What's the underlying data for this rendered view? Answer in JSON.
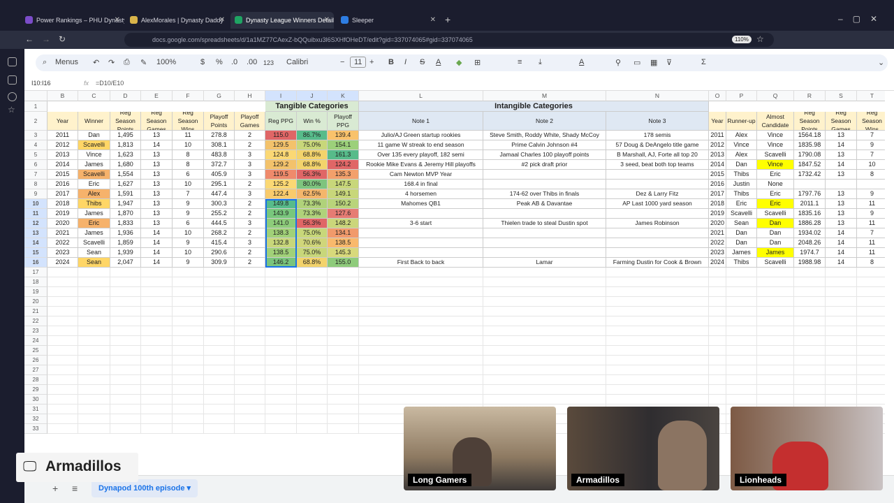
{
  "browser": {
    "tabs": [
      "Power Rankings – PHU Dynasty",
      "AlexMorales | Dynasty Daddy",
      "Dynasty League Winners Detail",
      "Sleeper"
    ],
    "url": "docs.google.com/spreadsheets/d/1a1MZ77CAexZ-bQQuibxu3l6SXHfOHeDT/edit?gid=337074065#gid=337074065",
    "zoom": "110%"
  },
  "toolbar": {
    "menus": "Menus",
    "zoom": "100%",
    "currency": "$",
    "percent": "%",
    "dec_minus": ".0",
    "dec_plus": ".00",
    "format_num": "123",
    "font": "Calibri",
    "font_size": "11",
    "bold": "B",
    "italic": "I",
    "strike": "S",
    "text_color": "A",
    "sum": "Σ"
  },
  "formula_bar": {
    "name_box": "I10:I16",
    "fx": "fx",
    "formula": "=D10/E10"
  },
  "columns": [
    "B",
    "C",
    "D",
    "E",
    "F",
    "G",
    "H",
    "I",
    "J",
    "K",
    "L",
    "M",
    "N",
    "O",
    "P",
    "Q",
    "R",
    "S",
    "T"
  ],
  "row_numbers": [
    "1",
    "2",
    "3",
    "4",
    "5",
    "6",
    "7",
    "8",
    "9",
    "10",
    "11",
    "12",
    "13",
    "14",
    "15",
    "16",
    "17",
    "18",
    "19",
    "20",
    "21",
    "22",
    "23",
    "24",
    "25",
    "26",
    "27",
    "28",
    "29",
    "30",
    "31",
    "32",
    "33"
  ],
  "group_headers": {
    "tangible": "Tangible Categories",
    "intangible": "Intangible Categories"
  },
  "headers": [
    "Year",
    "Winner",
    "Reg Season Points",
    "Reg Season Games",
    "Reg Season Wins",
    "Playoff Points",
    "Playoff Games",
    "Reg PPG",
    "Win %",
    "Playoff PPG",
    "Note 1",
    "Note 2",
    "Note 3",
    "Year",
    "Runner-up",
    "Almost Candidate",
    "Reg Season Points",
    "Reg Season Games",
    "Reg Season Wins"
  ],
  "rows": [
    [
      "2011",
      "Dan",
      "1,495",
      "13",
      "11",
      "278.8",
      "2",
      "115.0",
      "86.7%",
      "139.4",
      "Julio/AJ Green startup rookies",
      "Steve Smith, Roddy White, Shady McCoy",
      "178 semis",
      "2011",
      "Alex",
      "Vince",
      "1564.18",
      "13",
      "7"
    ],
    [
      "2012",
      "Scavelli",
      "1,813",
      "14",
      "10",
      "308.1",
      "2",
      "129.5",
      "75.0%",
      "154.1",
      "11 game W streak to end season",
      "Prime Calvin Johnson #4",
      "57 Doug & DeAngelo title game",
      "2012",
      "Vince",
      "Vince",
      "1835.98",
      "14",
      "9"
    ],
    [
      "2013",
      "Vince",
      "1,623",
      "13",
      "8",
      "483.8",
      "3",
      "124.8",
      "68.8%",
      "161.3",
      "Over 135 every playoff, 182 semi",
      "Jamaal Charles 100 playoff points",
      "B Marshall, AJ, Forte all top 20",
      "2013",
      "Alex",
      "Scavelli",
      "1790.08",
      "13",
      "7"
    ],
    [
      "2014",
      "James",
      "1,680",
      "13",
      "8",
      "372.7",
      "3",
      "129.2",
      "68.8%",
      "124.2",
      "Rookie Mike Evans & Jeremy Hill playoffs",
      "#2 pick draft prior",
      "3 seed, beat both top teams",
      "2014",
      "Dan",
      "Vince",
      "1847.52",
      "14",
      "10"
    ],
    [
      "2015",
      "Scavelli",
      "1,554",
      "13",
      "6",
      "405.9",
      "3",
      "119.5",
      "56.3%",
      "135.3",
      "Cam Newton MVP Year",
      "",
      "",
      "2015",
      "Thibs",
      "Eric",
      "1732.42",
      "13",
      "8"
    ],
    [
      "2016",
      "Eric",
      "1,627",
      "13",
      "10",
      "295.1",
      "2",
      "125.2",
      "80.0%",
      "147.5",
      "168.4 in final",
      "",
      "",
      "2016",
      "Justin",
      "None",
      "",
      "",
      ""
    ],
    [
      "2017",
      "Alex",
      "1,591",
      "13",
      "7",
      "447.4",
      "3",
      "122.4",
      "62.5%",
      "149.1",
      "4 horsemen",
      "174-62 over Thibs in finals",
      "Dez & Larry Fitz",
      "2017",
      "Thibs",
      "Eric",
      "1797.76",
      "13",
      "9"
    ],
    [
      "2018",
      "Thibs",
      "1,947",
      "13",
      "9",
      "300.3",
      "2",
      "149.8",
      "73.3%",
      "150.2",
      "Mahomes QB1",
      "Peak AB & Davantae",
      "AP Last 1000 yard season",
      "2018",
      "Eric",
      "Eric",
      "2011.1",
      "13",
      "11"
    ],
    [
      "2019",
      "James",
      "1,870",
      "13",
      "9",
      "255.2",
      "2",
      "143.9",
      "73.3%",
      "127.6",
      "",
      "",
      "",
      "2019",
      "Scavelli",
      "Scavelli",
      "1835.16",
      "13",
      "9"
    ],
    [
      "2020",
      "Eric",
      "1,833",
      "13",
      "6",
      "444.5",
      "3",
      "141.0",
      "56.3%",
      "148.2",
      "3-6 start",
      "Thielen trade to steal Dustin spot",
      "James Robinson",
      "2020",
      "Sean",
      "Dan",
      "1886.28",
      "13",
      "11"
    ],
    [
      "2021",
      "James",
      "1,936",
      "14",
      "10",
      "268.2",
      "2",
      "138.3",
      "75.0%",
      "134.1",
      "",
      "",
      "",
      "2021",
      "Dan",
      "Dan",
      "1934.02",
      "14",
      "7"
    ],
    [
      "2022",
      "Scavelli",
      "1,859",
      "14",
      "9",
      "415.4",
      "3",
      "132.8",
      "70.6%",
      "138.5",
      "",
      "",
      "",
      "2022",
      "Dan",
      "Dan",
      "2048.26",
      "14",
      "11"
    ],
    [
      "2023",
      "Sean",
      "1,939",
      "14",
      "10",
      "290.6",
      "2",
      "138.5",
      "75.0%",
      "145.3",
      "",
      "",
      "",
      "2023",
      "James",
      "James",
      "1974.7",
      "14",
      "11"
    ],
    [
      "2024",
      "Sean",
      "2,047",
      "14",
      "9",
      "309.9",
      "2",
      "146.2",
      "68.8%",
      "155.0",
      "First Back to back",
      "Lamar",
      "Farming Dustin for Cook & Brown",
      "2024",
      "Thibs",
      "Scavelli",
      "1988.98",
      "14",
      "8"
    ]
  ],
  "cell_colors": {
    "winner": [
      "",
      "#ffd666",
      "",
      "",
      "#f6b26b",
      "",
      "#f6b26b",
      "#ffd666",
      "",
      "#f6b26b",
      "",
      "",
      "",
      "#ffd666"
    ],
    "reg_ppg": [
      "#e06666",
      "#f3c26b",
      "#fbd874",
      "#f3c26b",
      "#ef8a6b",
      "#fbd874",
      "#f9cb6c",
      "#57bb8a",
      "#78c77c",
      "#8dcc7a",
      "#a1d178",
      "#c8d77a",
      "#a1d178",
      "#7ac47c"
    ],
    "win_pct": [
      "#57bb8a",
      "#c8d77a",
      "#f3d36b",
      "#f3d36b",
      "#e06666",
      "#7ec47e",
      "#f4b66b",
      "#b0d27a",
      "#b0d27a",
      "#e06666",
      "#c8d77a",
      "#d0d67a",
      "#c8d77a",
      "#f3d36b"
    ],
    "playoff_ppg": [
      "#f9c26b",
      "#9cd07a",
      "#57bb8a",
      "#e06666",
      "#f3a06b",
      "#c8d77a",
      "#c8d77a",
      "#b9d47a",
      "#e67c73",
      "#cbd67a",
      "#f19a6b",
      "#f9b96c",
      "#d8d97b",
      "#8ecb7b"
    ],
    "almost": [
      "",
      "",
      "",
      "#ffff00",
      "",
      "",
      "",
      "#ffff00",
      "",
      "#ffff00",
      "",
      "",
      "#ffff00",
      ""
    ]
  },
  "sheet_tab": "Dynapod 100th episode",
  "overlay": {
    "show_name": "Armadillos",
    "cams": [
      "Long Gamers",
      "Armadillos",
      "Lionheads"
    ]
  }
}
